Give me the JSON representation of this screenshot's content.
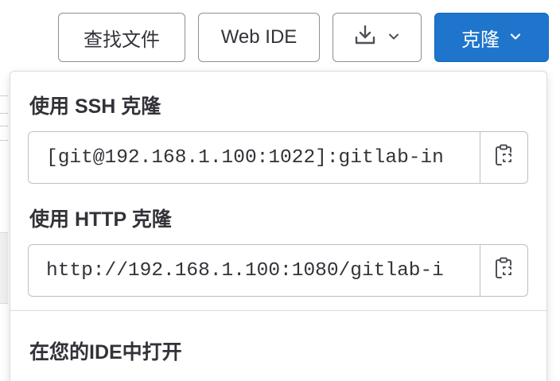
{
  "toolbar": {
    "find_file_label": "查找文件",
    "web_ide_label": "Web IDE",
    "download_icon": "download-icon",
    "clone_label": "克隆",
    "accent_color": "#1f75cb"
  },
  "clone_dropdown": {
    "ssh_label": "使用 SSH 克隆",
    "ssh_url": "[git@192.168.1.100:1022]:gitlab-in",
    "http_label": "使用 HTTP 克隆",
    "http_url": "http://192.168.1.100:1080/gitlab-i",
    "open_in_ide_label": "在您的IDE中打开",
    "copy_icon": "copy-to-clipboard-icon"
  }
}
